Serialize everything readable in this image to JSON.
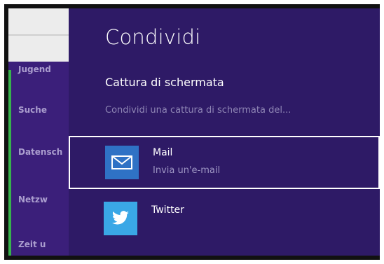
{
  "background_app": {
    "items": [
      {
        "label": "Jugend"
      },
      {
        "label": "Suche"
      },
      {
        "label": "Datensch"
      },
      {
        "label": "Netzw"
      },
      {
        "label": "Zeit u"
      }
    ]
  },
  "share": {
    "title": "Condividi",
    "subtitle": "Cattura di schermata",
    "description": "Condividi una cattura di schermata del...",
    "targets": [
      {
        "name": "Mail",
        "subtitle": "Invia un'e-mail",
        "icon": "mail-icon",
        "color": "#2f72c5",
        "selected": true
      },
      {
        "name": "Twitter",
        "subtitle": "",
        "icon": "twitter-icon",
        "color": "#3aa7e6",
        "selected": false
      }
    ]
  },
  "colors": {
    "panel": "#2e1a66",
    "accent_green": "#37b24d"
  }
}
